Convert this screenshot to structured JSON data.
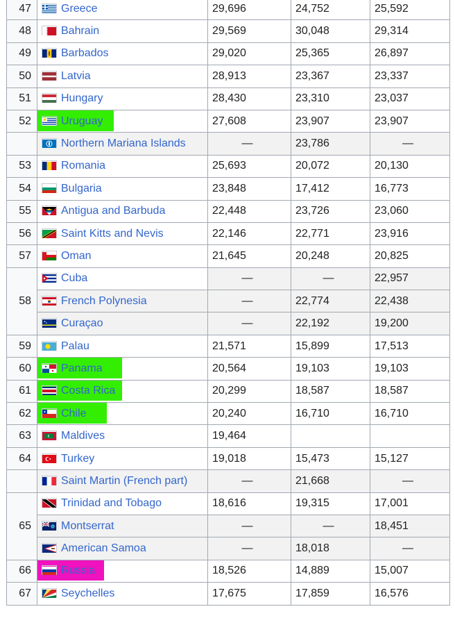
{
  "rows": [
    {
      "rank": "47",
      "country": "Greece",
      "flag": "greece-flag",
      "v1": "29,696",
      "v2": "24,752",
      "v3": "25,592",
      "sub": false,
      "hl": ""
    },
    {
      "rank": "48",
      "country": "Bahrain",
      "flag": "bahrain-flag",
      "v1": "29,569",
      "v2": "30,048",
      "v3": "29,314",
      "sub": false,
      "hl": ""
    },
    {
      "rank": "49",
      "country": "Barbados",
      "flag": "barbados-flag",
      "v1": "29,020",
      "v2": "25,365",
      "v3": "26,897",
      "sub": false,
      "hl": ""
    },
    {
      "rank": "50",
      "country": "Latvia",
      "flag": "latvia-flag",
      "v1": "28,913",
      "v2": "23,367",
      "v3": "23,337",
      "sub": false,
      "hl": ""
    },
    {
      "rank": "51",
      "country": "Hungary",
      "flag": "hungary-flag",
      "v1": "28,430",
      "v2": "23,310",
      "v3": "23,037",
      "sub": false,
      "hl": ""
    },
    {
      "rank": "52",
      "country": "Uruguay",
      "flag": "uruguay-flag",
      "v1": "27,608",
      "v2": "23,907",
      "v3": "23,907",
      "sub": false,
      "hl": "green"
    },
    {
      "rank": "",
      "country": "Northern Mariana Islands",
      "flag": "northern-mariana-islands-flag",
      "v1": "—",
      "v2": "23,786",
      "v3": "—",
      "sub": true,
      "hl": ""
    },
    {
      "rank": "53",
      "country": "Romania",
      "flag": "romania-flag",
      "v1": "25,693",
      "v2": "20,072",
      "v3": "20,130",
      "sub": false,
      "hl": ""
    },
    {
      "rank": "54",
      "country": "Bulgaria",
      "flag": "bulgaria-flag",
      "v1": "23,848",
      "v2": "17,412",
      "v3": "16,773",
      "sub": false,
      "hl": ""
    },
    {
      "rank": "55",
      "country": "Antigua and Barbuda",
      "flag": "antigua-and-barbuda-flag",
      "v1": "22,448",
      "v2": "23,726",
      "v3": "23,060",
      "sub": false,
      "hl": ""
    },
    {
      "rank": "56",
      "country": "Saint Kitts and Nevis",
      "flag": "saint-kitts-and-nevis-flag",
      "v1": "22,146",
      "v2": "22,771",
      "v3": "23,916",
      "sub": false,
      "hl": ""
    },
    {
      "rank": "57",
      "country": "Oman",
      "flag": "oman-flag",
      "v1": "21,645",
      "v2": "20,248",
      "v3": "20,825",
      "sub": false,
      "hl": ""
    },
    {
      "rank": "58",
      "country": "Cuba",
      "flag": "cuba-flag",
      "v1": "—",
      "v2": "—",
      "v3": "22,957",
      "sub": false,
      "hl": "",
      "rowspan": 3
    },
    {
      "rank": "",
      "country": "French Polynesia",
      "flag": "french-polynesia-flag",
      "v1": "—",
      "v2": "22,774",
      "v3": "22,438",
      "sub": true,
      "hl": "",
      "norank": true
    },
    {
      "rank": "",
      "country": "Curaçao",
      "flag": "curacao-flag",
      "v1": "—",
      "v2": "22,192",
      "v3": "19,200",
      "sub": true,
      "hl": "",
      "norank": true
    },
    {
      "rank": "59",
      "country": "Palau",
      "flag": "palau-flag",
      "v1": "21,571",
      "v2": "15,899",
      "v3": "17,513",
      "sub": false,
      "hl": ""
    },
    {
      "rank": "60",
      "country": "Panama",
      "flag": "panama-flag",
      "v1": "20,564",
      "v2": "19,103",
      "v3": "19,103",
      "sub": false,
      "hl": "green"
    },
    {
      "rank": "61",
      "country": "Costa Rica",
      "flag": "costa-rica-flag",
      "v1": "20,299",
      "v2": "18,587",
      "v3": "18,587",
      "sub": false,
      "hl": "green"
    },
    {
      "rank": "62",
      "country": "Chile",
      "flag": "chile-flag",
      "v1": "20,240",
      "v2": "16,710",
      "v3": "16,710",
      "sub": false,
      "hl": "green"
    },
    {
      "rank": "63",
      "country": "Maldives",
      "flag": "maldives-flag",
      "v1": "19,464",
      "v2": "",
      "v3": "",
      "sub": false,
      "hl": ""
    },
    {
      "rank": "64",
      "country": "Turkey",
      "flag": "turkey-flag",
      "v1": "19,018",
      "v2": "15,473",
      "v3": "15,127",
      "sub": false,
      "hl": ""
    },
    {
      "rank": "",
      "country": "Saint Martin (French part)",
      "flag": "saint-martin-flag",
      "v1": "—",
      "v2": "21,668",
      "v3": "—",
      "sub": true,
      "hl": ""
    },
    {
      "rank": "65",
      "country": "Trinidad and Tobago",
      "flag": "trinidad-and-tobago-flag",
      "v1": "18,616",
      "v2": "19,315",
      "v3": "17,001",
      "sub": false,
      "hl": "",
      "rowspan": 3
    },
    {
      "rank": "",
      "country": "Montserrat",
      "flag": "montserrat-flag",
      "v1": "—",
      "v2": "—",
      "v3": "18,451",
      "sub": true,
      "hl": "",
      "norank": true
    },
    {
      "rank": "",
      "country": "American Samoa",
      "flag": "american-samoa-flag",
      "v1": "—",
      "v2": "18,018",
      "v3": "—",
      "sub": true,
      "hl": "",
      "norank": true
    },
    {
      "rank": "66",
      "country": "Russia",
      "flag": "russia-flag",
      "v1": "18,526",
      "v2": "14,889",
      "v3": "15,007",
      "sub": false,
      "hl": "pink"
    },
    {
      "rank": "67",
      "country": "Seychelles",
      "flag": "seychelles-flag",
      "v1": "17,675",
      "v2": "17,859",
      "v3": "16,576",
      "sub": false,
      "hl": ""
    }
  ],
  "colors": {
    "link": "#3366cc",
    "highlight_green": "#33ee00",
    "highlight_pink": "#f012be",
    "border": "#a2a9b1",
    "sub_row_bg": "#f2f2f2"
  }
}
